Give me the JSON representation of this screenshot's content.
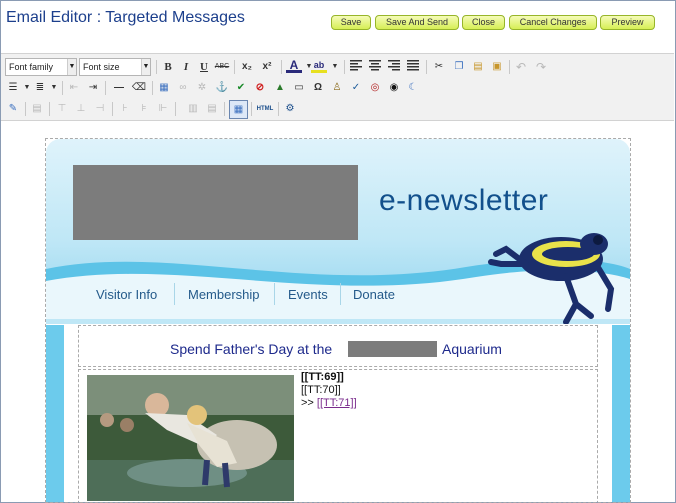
{
  "header": {
    "title": "Email Editor : Targeted Messages",
    "buttons": [
      "Save",
      "Save And Send",
      "Close",
      "Cancel Changes",
      "Preview"
    ]
  },
  "toolbar": {
    "font_family": "Font family",
    "font_size": "Font size",
    "row1": {
      "bold": "B",
      "italic": "I",
      "underline": "U",
      "strike": "ABC",
      "subscript": "x₂",
      "superscript": "x²",
      "font_color": "A",
      "highlight": "ab"
    },
    "row3": {
      "html": "HTML"
    }
  },
  "newsletter": {
    "brand_text": "e-newsletter",
    "nav": [
      "Visitor Info",
      "Membership",
      "Events",
      "Donate"
    ],
    "headline_pre": "Spend Father's Day at the",
    "headline_post": "Aquarium",
    "tokens": {
      "t1": "[[TT:69]]",
      "t2": "[[TT:70]]",
      "t3_prefix": ">>",
      "t3": "[[TT:71]]"
    }
  },
  "colors": {
    "title": "#1c3f8c",
    "button_gradient_top": "#f5fcb8",
    "button_gradient_bottom": "#d6ef55",
    "brand": "#12508c",
    "nav_text": "#245a8a",
    "headline": "#1e2a8c",
    "link": "#7a2b8c"
  }
}
